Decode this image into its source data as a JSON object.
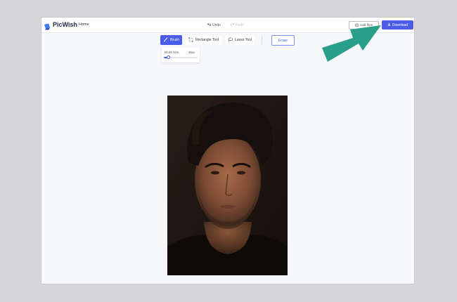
{
  "app": {
    "name": "PicWish"
  },
  "nav": {
    "home": "Home"
  },
  "history": {
    "undo": "Undo",
    "redo": "Redo"
  },
  "actions": {
    "add_files": "Add files",
    "download": "Download"
  },
  "tools": {
    "brush": "Brush",
    "rectangle": "Rectangle Tool",
    "lasso": "Lasso Tool",
    "erase": "Erase",
    "active": "brush"
  },
  "brush_panel": {
    "label": "Brush Size",
    "value": "48px",
    "level": 0.12
  },
  "colors": {
    "accent": "#4b5de8",
    "arrow": "#2aa08a",
    "canvas_bg": "#f6f7fb",
    "outer_bg": "#d6d6d9"
  },
  "icons": {
    "logo": "picwish-logo-icon",
    "undo": "undo-icon",
    "redo": "redo-icon",
    "add_files": "add-files-icon",
    "download": "download-icon",
    "brush": "brush-icon",
    "rectangle": "rectangle-select-icon",
    "lasso": "lasso-icon"
  }
}
